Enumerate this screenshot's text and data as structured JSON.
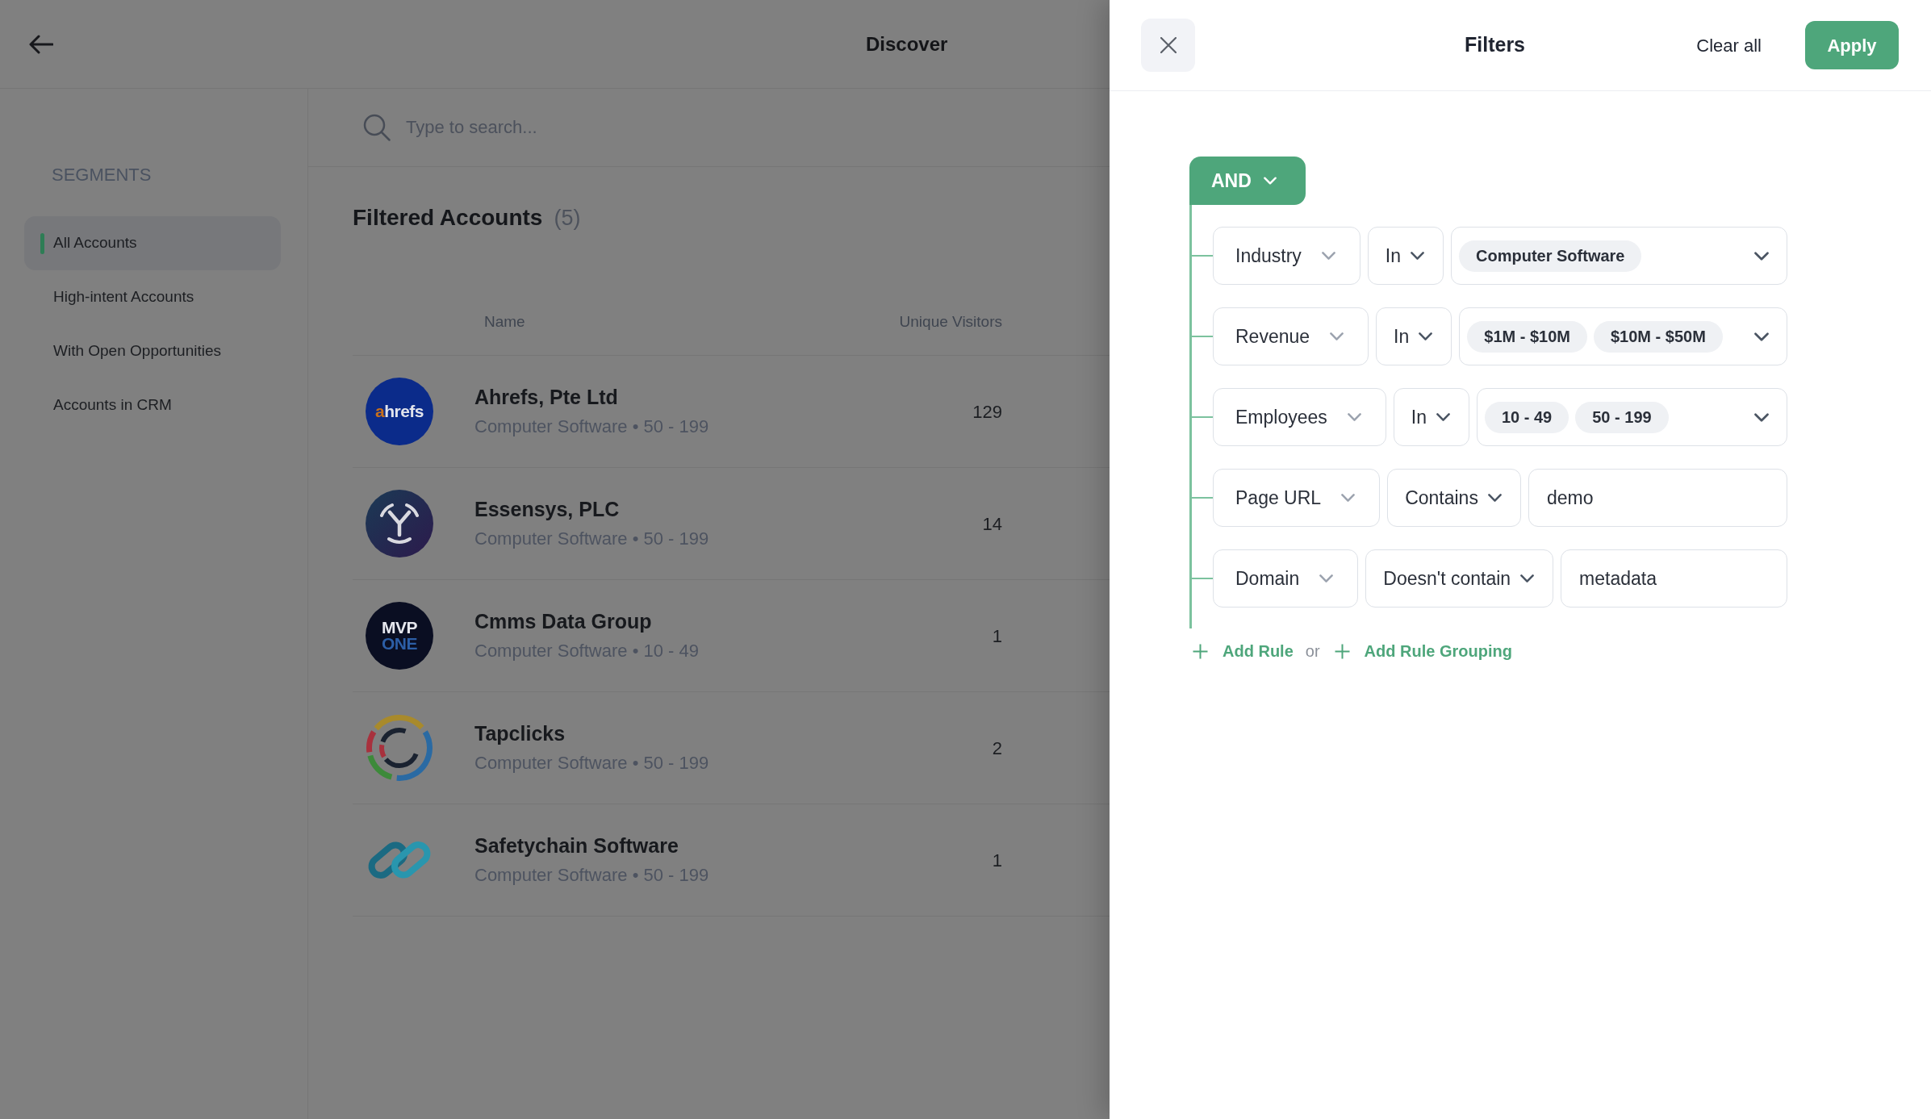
{
  "header": {
    "title": "Discover"
  },
  "sidebar": {
    "heading": "SEGMENTS",
    "items": [
      {
        "label": "All Accounts",
        "selected": true
      },
      {
        "label": "High-intent Accounts",
        "selected": false
      },
      {
        "label": "With Open Opportunities",
        "selected": false
      },
      {
        "label": "Accounts in CRM",
        "selected": false
      }
    ]
  },
  "search": {
    "placeholder": "Type to search..."
  },
  "accounts": {
    "title": "Filtered Accounts",
    "count": "(5)",
    "columns": [
      "Name",
      "Unique Visitors"
    ],
    "rows": [
      {
        "logo": {
          "kind": "wordmark",
          "text": "ahrefs"
        },
        "name": "Ahrefs, Pte Ltd",
        "details": "Computer Software • 50 - 199",
        "unique_visitors": "129"
      },
      {
        "logo": {
          "kind": "emblem"
        },
        "name": "Essensys, PLC",
        "details": "Computer Software • 50 - 199",
        "unique_visitors": "14"
      },
      {
        "logo": {
          "kind": "stacked",
          "lines": [
            "MVP",
            "ONE"
          ]
        },
        "name": "Cmms Data Group",
        "details": "Computer Software • 10 - 49",
        "unique_visitors": "1"
      },
      {
        "logo": {
          "kind": "ring"
        },
        "name": "Tapclicks",
        "details": "Computer Software • 50 - 199",
        "unique_visitors": "2"
      },
      {
        "logo": {
          "kind": "links"
        },
        "name": "Safetychain Software",
        "details": "Computer Software • 50 - 199",
        "unique_visitors": "1"
      }
    ]
  },
  "filters": {
    "title": "Filters",
    "clear_all": "Clear all",
    "apply": "Apply",
    "operator": "AND",
    "rules": [
      {
        "kind": "chips",
        "field": "Industry",
        "condition": "In",
        "values": [
          "Computer Software"
        ]
      },
      {
        "kind": "chips",
        "field": "Revenue",
        "condition": "In",
        "values": [
          "$1M - $10M",
          "$10M - $50M"
        ]
      },
      {
        "kind": "chips",
        "field": "Employees",
        "condition": "In",
        "values": [
          "10 - 49",
          "50 - 199"
        ]
      },
      {
        "kind": "text",
        "field": "Page URL",
        "condition": "Contains",
        "value": "demo"
      },
      {
        "kind": "text",
        "field": "Domain",
        "condition": "Doesn't contain",
        "value": "metadata"
      }
    ],
    "add_rule": "Add Rule",
    "separator": "or",
    "add_rule_grouping": "Add Rule Grouping"
  }
}
